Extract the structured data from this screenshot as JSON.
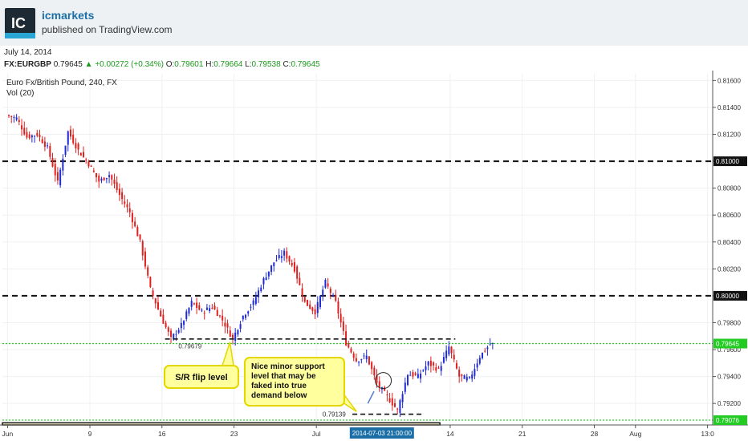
{
  "header": {
    "logo_text": "IC",
    "brand": "icmarkets",
    "published": "published on TradingView.com"
  },
  "info": {
    "date": "July 14, 2014",
    "symbol": "FX:EURGBP",
    "last": "0.79645",
    "change": "+0.00272 (+0.34%)",
    "open_label": "O:",
    "open": "0.79601",
    "high_label": "H:",
    "high": "0.79664",
    "low_label": "L:",
    "low": "0.79538",
    "close_label": "C:",
    "close": "0.79645"
  },
  "chart_title": "Euro Fx/British Pound, 240, FX",
  "volume_label": "Vol (20)",
  "colors": {
    "up": "#1f2bd6",
    "down": "#e0201f",
    "green": "#22cc22",
    "highlight": "#1b6fa6"
  },
  "chart_data": {
    "type": "candlestick",
    "title": "Euro Fx/British Pound, 240, FX",
    "x_ticks": [
      "Jun",
      "9",
      "16",
      "23",
      "Jul",
      "14",
      "21",
      "28",
      "Aug",
      "13:0"
    ],
    "x_tick_days": [
      1,
      9,
      16,
      23,
      31,
      44,
      51,
      58,
      62,
      69
    ],
    "y_ticks": [
      "0.81600",
      "0.81400",
      "0.81200",
      "0.81000",
      "0.80800",
      "0.80600",
      "0.80400",
      "0.80200",
      "0.80000",
      "0.79800",
      "0.79600",
      "0.79400",
      "0.79200"
    ],
    "ylim": [
      0.7904,
      0.8165
    ],
    "xlim_days": [
      0.5,
      69.5
    ],
    "crosshair_date": "2014-07-03 21:00:00",
    "levels": [
      {
        "price": 0.81,
        "label": "0.81000",
        "style": "dashed-black"
      },
      {
        "price": 0.8,
        "label": "0.80000",
        "style": "dashed-black"
      },
      {
        "price": 0.79645,
        "label": "0.79645",
        "style": "dotted-green"
      },
      {
        "price": 0.79076,
        "label": "0.79076",
        "style": "dotted-green"
      }
    ],
    "annotations": [
      {
        "text": "0.79679"
      },
      {
        "text": "0.79139"
      }
    ],
    "callouts": [
      {
        "text": "S/R flip level"
      },
      {
        "text": "Nice minor support level that may be faked into true demand below"
      }
    ],
    "close_path": [
      [
        1.0,
        0.8134
      ],
      [
        2.0,
        0.8132
      ],
      [
        3.0,
        0.8118
      ],
      [
        4.0,
        0.812
      ],
      [
        5.0,
        0.811
      ],
      [
        6.0,
        0.8084
      ],
      [
        7.0,
        0.8122
      ],
      [
        8.0,
        0.8108
      ],
      [
        9.0,
        0.8098
      ],
      [
        10.0,
        0.8085
      ],
      [
        11.0,
        0.809
      ],
      [
        12.0,
        0.8075
      ],
      [
        13.0,
        0.8062
      ],
      [
        14.0,
        0.804
      ],
      [
        15.0,
        0.8005
      ],
      [
        16.0,
        0.7985
      ],
      [
        17.0,
        0.7968
      ],
      [
        18.0,
        0.7978
      ],
      [
        19.0,
        0.7995
      ],
      [
        20.0,
        0.7988
      ],
      [
        21.0,
        0.7992
      ],
      [
        22.0,
        0.7982
      ],
      [
        23.0,
        0.7968
      ],
      [
        24.0,
        0.7985
      ],
      [
        25.0,
        0.7995
      ],
      [
        26.0,
        0.8012
      ],
      [
        27.0,
        0.8025
      ],
      [
        28.0,
        0.8032
      ],
      [
        29.0,
        0.802
      ],
      [
        30.0,
        0.7995
      ],
      [
        31.0,
        0.7988
      ],
      [
        32.0,
        0.801
      ],
      [
        33.0,
        0.7995
      ],
      [
        34.0,
        0.7965
      ],
      [
        35.0,
        0.7952
      ],
      [
        36.0,
        0.7955
      ],
      [
        37.0,
        0.7935
      ],
      [
        38.0,
        0.7925
      ],
      [
        39.0,
        0.7915
      ],
      [
        40.0,
        0.7942
      ],
      [
        41.0,
        0.794
      ],
      [
        42.0,
        0.795
      ],
      [
        43.0,
        0.7945
      ],
      [
        44.0,
        0.7962
      ],
      [
        45.0,
        0.794
      ],
      [
        46.0,
        0.7938
      ],
      [
        47.0,
        0.7955
      ],
      [
        48.0,
        0.7964
      ]
    ]
  }
}
